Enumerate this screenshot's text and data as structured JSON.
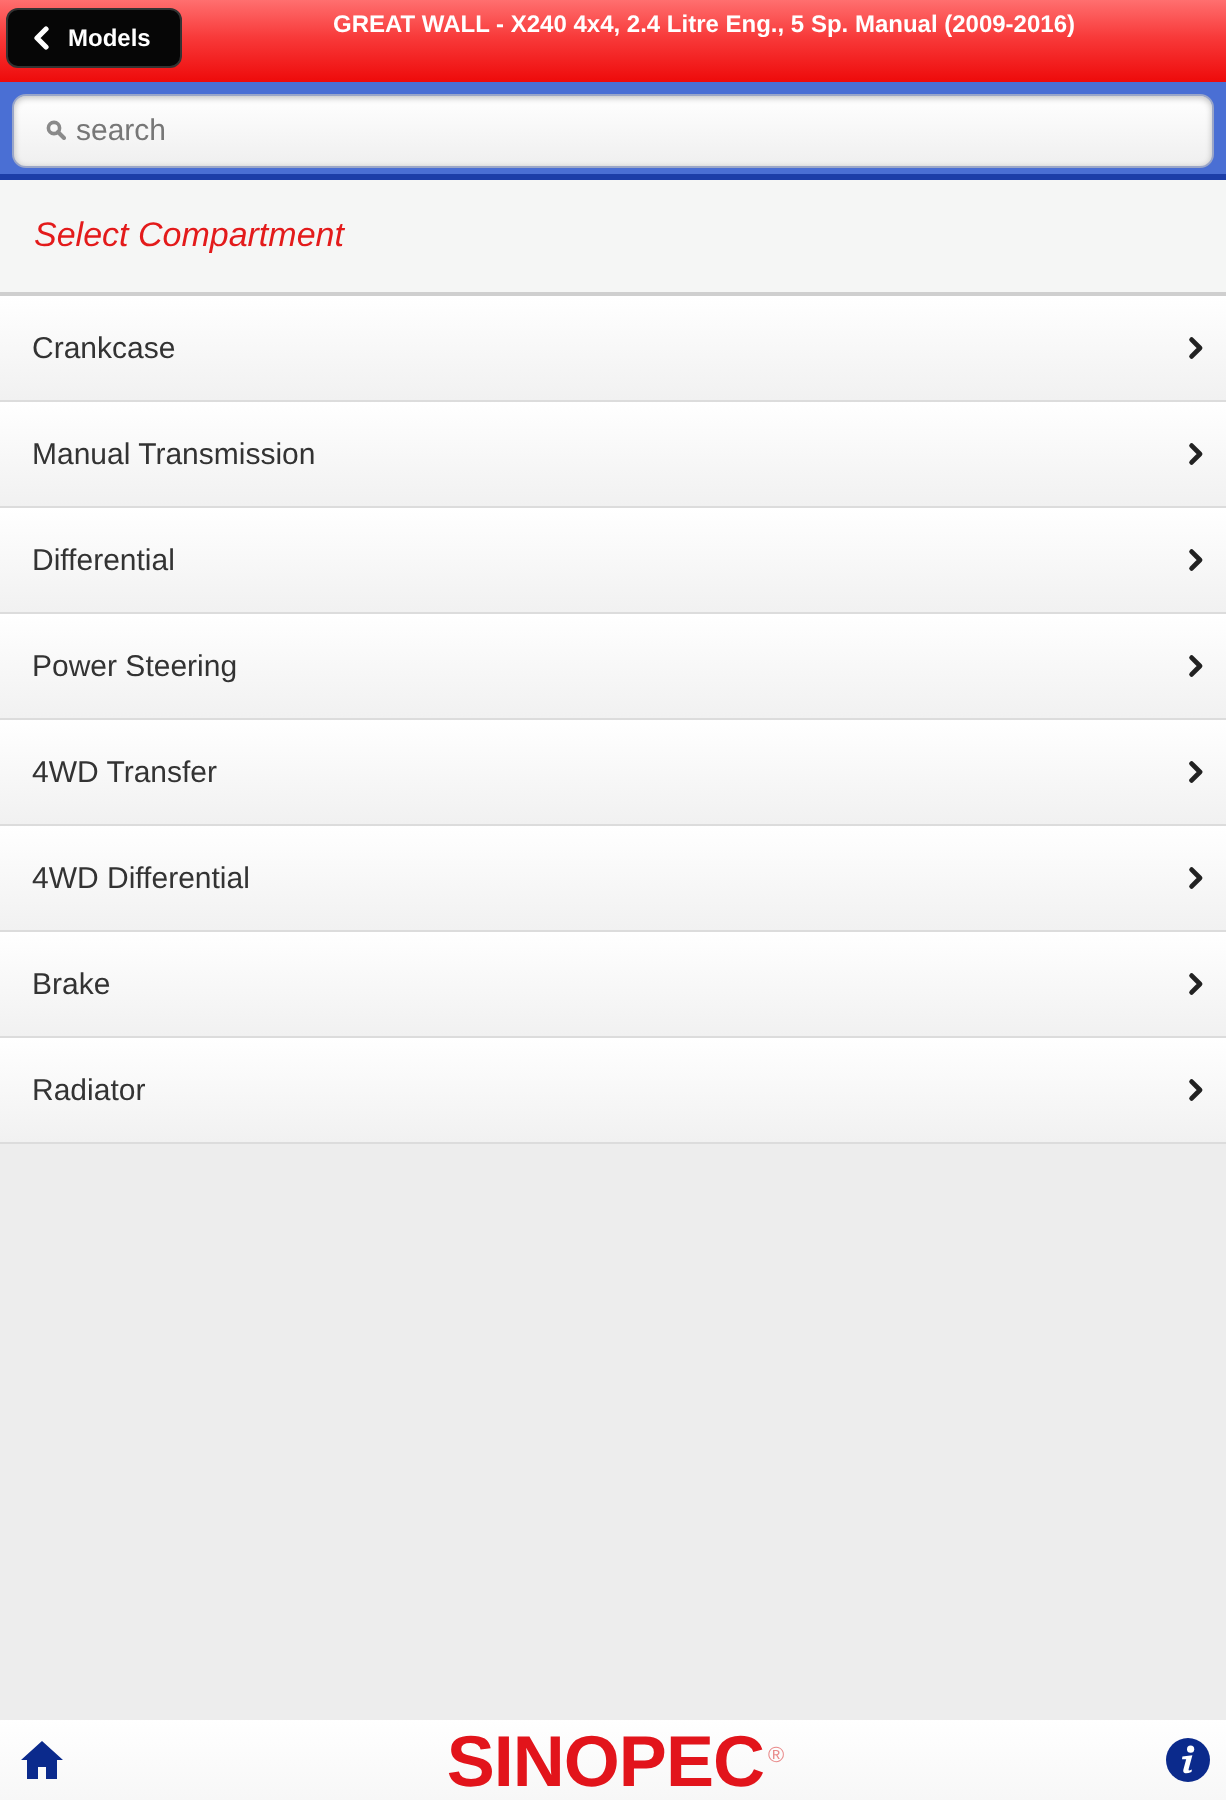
{
  "header": {
    "back_button": "Models",
    "title": "GREAT WALL - X240 4x4, 2.4 Litre Eng., 5 Sp. Manual (2009-2016)"
  },
  "search": {
    "placeholder": "search"
  },
  "section_title": "Select Compartment",
  "compartments": [
    {
      "label": "Crankcase"
    },
    {
      "label": "Manual Transmission"
    },
    {
      "label": "Differential"
    },
    {
      "label": "Power Steering"
    },
    {
      "label": "4WD Transfer"
    },
    {
      "label": "4WD Differential"
    },
    {
      "label": "Brake"
    },
    {
      "label": "Radiator"
    }
  ],
  "footer": {
    "logo": "SINOPEC$^{®}$"
  }
}
